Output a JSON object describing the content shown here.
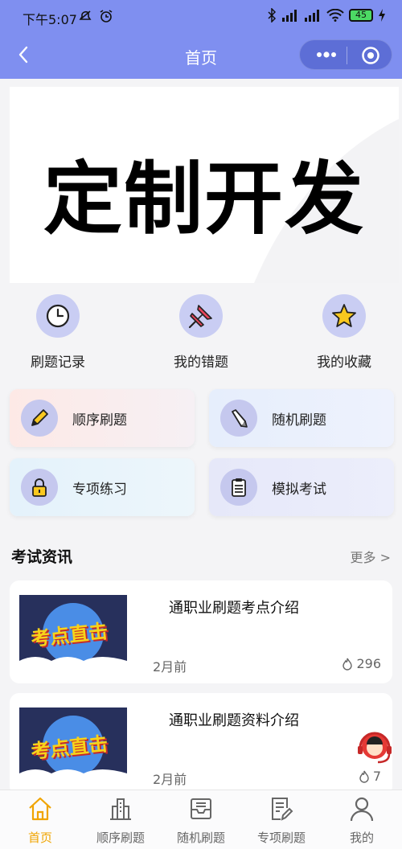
{
  "status": {
    "time": "下午5:07",
    "battery": "45"
  },
  "nav": {
    "title": "首页"
  },
  "banner": {
    "text": "定制开发"
  },
  "quick": [
    {
      "label": "刷题记录",
      "icon": "clock-icon"
    },
    {
      "label": "我的错题",
      "icon": "pin-icon"
    },
    {
      "label": "我的收藏",
      "icon": "star-icon"
    }
  ],
  "practice": [
    {
      "label": "顺序刷题",
      "icon": "pencil-icon"
    },
    {
      "label": "随机刷题",
      "icon": "pen-icon"
    },
    {
      "label": "专项练习",
      "icon": "lock-icon"
    },
    {
      "label": "模拟考试",
      "icon": "clipboard-icon"
    }
  ],
  "news_section": {
    "title": "考试资讯",
    "more": "更多 >"
  },
  "news": [
    {
      "title": "通职业刷题考点介绍",
      "ago": "2月前",
      "views": "296",
      "thumb_text": "考点直击"
    },
    {
      "title": "通职业刷题资料介绍",
      "ago": "2月前",
      "views": "7",
      "thumb_text": "考点直击"
    }
  ],
  "tabs": [
    {
      "label": "首页",
      "icon": "home-icon",
      "active": true
    },
    {
      "label": "顺序刷题",
      "icon": "building-icon"
    },
    {
      "label": "随机刷题",
      "icon": "inbox-icon"
    },
    {
      "label": "专项刷题",
      "icon": "document-edit-icon"
    },
    {
      "label": "我的",
      "icon": "user-icon"
    }
  ],
  "colors": {
    "accent": "#7f8ff0",
    "active_tab": "#f0a400"
  }
}
